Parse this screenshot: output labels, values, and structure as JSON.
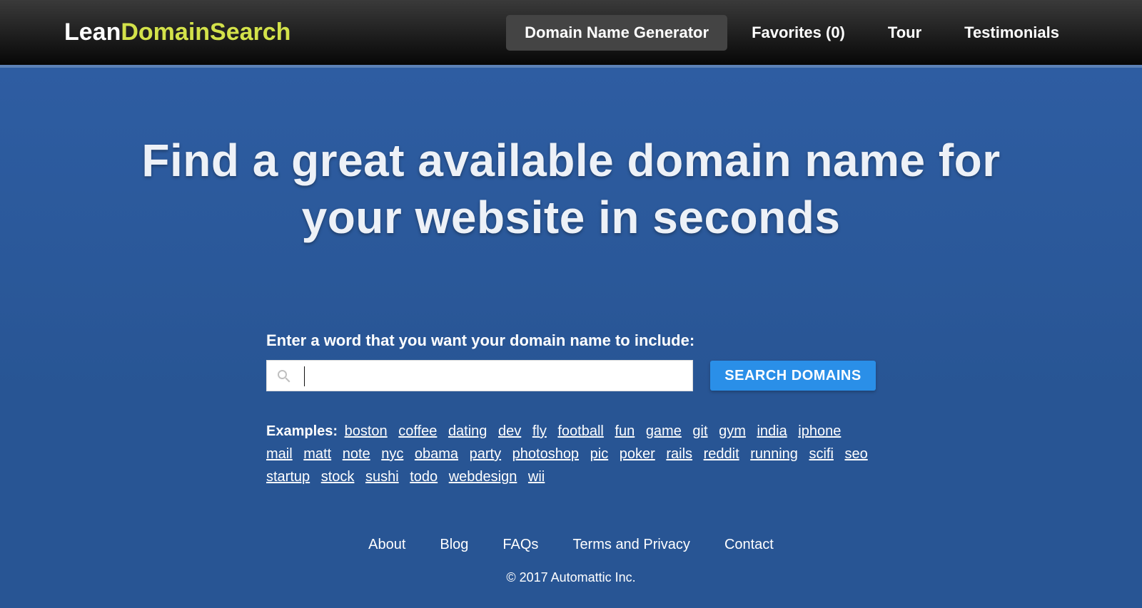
{
  "logo": {
    "part1": "Lean",
    "part2": "DomainSearch"
  },
  "nav": {
    "items": [
      {
        "label": "Domain Name Generator",
        "active": true
      },
      {
        "label": "Favorites (0)"
      },
      {
        "label": "Tour"
      },
      {
        "label": "Testimonials"
      }
    ]
  },
  "hero": {
    "headline": "Find a great available domain name for your website in seconds",
    "search_label": "Enter a word that you want your domain name to include:",
    "search_button": "SEARCH DOMAINS",
    "search_value": "",
    "search_placeholder": ""
  },
  "examples": {
    "label": "Examples:",
    "items": [
      "boston",
      "coffee",
      "dating",
      "dev",
      "fly",
      "football",
      "fun",
      "game",
      "git",
      "gym",
      "india",
      "iphone",
      "mail",
      "matt",
      "note",
      "nyc",
      "obama",
      "party",
      "photoshop",
      "pic",
      "poker",
      "rails",
      "reddit",
      "running",
      "scifi",
      "seo",
      "startup",
      "stock",
      "sushi",
      "todo",
      "webdesign",
      "wii"
    ]
  },
  "footer": {
    "links": [
      "About",
      "Blog",
      "FAQs",
      "Terms and Privacy",
      "Contact"
    ],
    "copyright": "© 2017 Automattic Inc."
  }
}
